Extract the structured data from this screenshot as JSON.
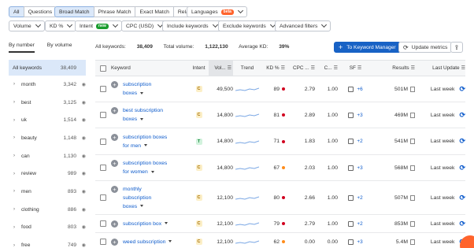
{
  "top_tabs": {
    "all": "All",
    "questions": "Questions",
    "broad": "Broad Match",
    "phrase": "Phrase Match",
    "exact": "Exact Match",
    "related": "Related",
    "languages": "Languages",
    "languages_badge": "beta"
  },
  "filters": {
    "volume": "Volume",
    "kd": "KD %",
    "intent": "Intent",
    "intent_badge": "new",
    "cpc": "CPC (USD)",
    "include": "Include keywords",
    "exclude": "Exclude keywords",
    "advanced": "Advanced filters"
  },
  "side_tabs": {
    "by_number": "By number",
    "by_volume": "By volume"
  },
  "sidebar": {
    "all_label": "All keywords",
    "all_count": "38,409",
    "items": [
      {
        "label": "month",
        "count": "3,342"
      },
      {
        "label": "best",
        "count": "3,125"
      },
      {
        "label": "uk",
        "count": "1,514"
      },
      {
        "label": "beauty",
        "count": "1,148"
      },
      {
        "label": "can",
        "count": "1,130"
      },
      {
        "label": "review",
        "count": "989"
      },
      {
        "label": "men",
        "count": "893"
      },
      {
        "label": "clothing",
        "count": "886"
      },
      {
        "label": "food",
        "count": "803"
      },
      {
        "label": "free",
        "count": "749"
      }
    ]
  },
  "stats": {
    "all_keywords_label": "All keywords:",
    "all_keywords_value": "38,409",
    "total_volume_label": "Total volume:",
    "total_volume_value": "1,122,130",
    "avg_kd_label": "Average KD:",
    "avg_kd_value": "39%"
  },
  "actions": {
    "to_keyword_manager": "To Keyword Manager",
    "update_metrics": "Update metrics"
  },
  "columns": {
    "keyword": "Keyword",
    "intent": "Intent",
    "volume": "Vol...",
    "trend": "Trend",
    "kd": "KD %",
    "cpc": "CPC ...",
    "com": "C...",
    "sf": "SF",
    "results": "Results",
    "last_update": "Last Update"
  },
  "rows": [
    {
      "lines": [
        "subscription",
        "boxes"
      ],
      "intent": "C",
      "volume": "49,500",
      "kd": "89",
      "kd_color": "#d1001f",
      "cpc": "2.79",
      "com": "1.00",
      "sf_more": "+6",
      "results": "501M",
      "updated": "Last week",
      "height": 33
    },
    {
      "lines": [
        "best subscription",
        "boxes"
      ],
      "intent": "C",
      "volume": "14,800",
      "kd": "81",
      "kd_color": "#d1001f",
      "cpc": "2.89",
      "com": "1.00",
      "sf_more": "+3",
      "results": "469M",
      "updated": "Last week",
      "height": 33
    },
    {
      "lines": [
        "subscription boxes",
        "for men"
      ],
      "intent": "T",
      "volume": "14,800",
      "kd": "71",
      "kd_color": "#d1001f",
      "cpc": "1.83",
      "com": "1.00",
      "sf_more": "+2",
      "results": "541M",
      "updated": "Last week",
      "height": 34
    },
    {
      "lines": [
        "subscription boxes",
        "for women"
      ],
      "intent": "C",
      "volume": "14,800",
      "kd": "67",
      "kd_color": "#ff8c1a",
      "cpc": "2.03",
      "com": "1.00",
      "sf_more": "+3",
      "results": "568M",
      "updated": "Last week",
      "height": 33
    },
    {
      "lines": [
        "monthly",
        "subscription",
        "boxes"
      ],
      "intent": "C",
      "volume": "12,100",
      "kd": "80",
      "kd_color": "#d1001f",
      "cpc": "2.66",
      "com": "1.00",
      "sf_more": "+2",
      "results": "507M",
      "updated": "Last week",
      "height": 43
    },
    {
      "lines": [
        "subscription box"
      ],
      "intent": "C",
      "volume": "12,100",
      "kd": "79",
      "kd_color": "#d1001f",
      "cpc": "2.79",
      "com": "1.00",
      "sf_more": "+2",
      "results": "853M",
      "updated": "Last week",
      "height": 23
    },
    {
      "lines": [
        "weed subscription"
      ],
      "intent": "C",
      "volume": "12,100",
      "kd": "62",
      "kd_color": "#ff8c1a",
      "cpc": "0.00",
      "com": "0.00",
      "sf_more": "+3",
      "results": "5.4M",
      "updated": "Last week",
      "height": 23
    }
  ]
}
